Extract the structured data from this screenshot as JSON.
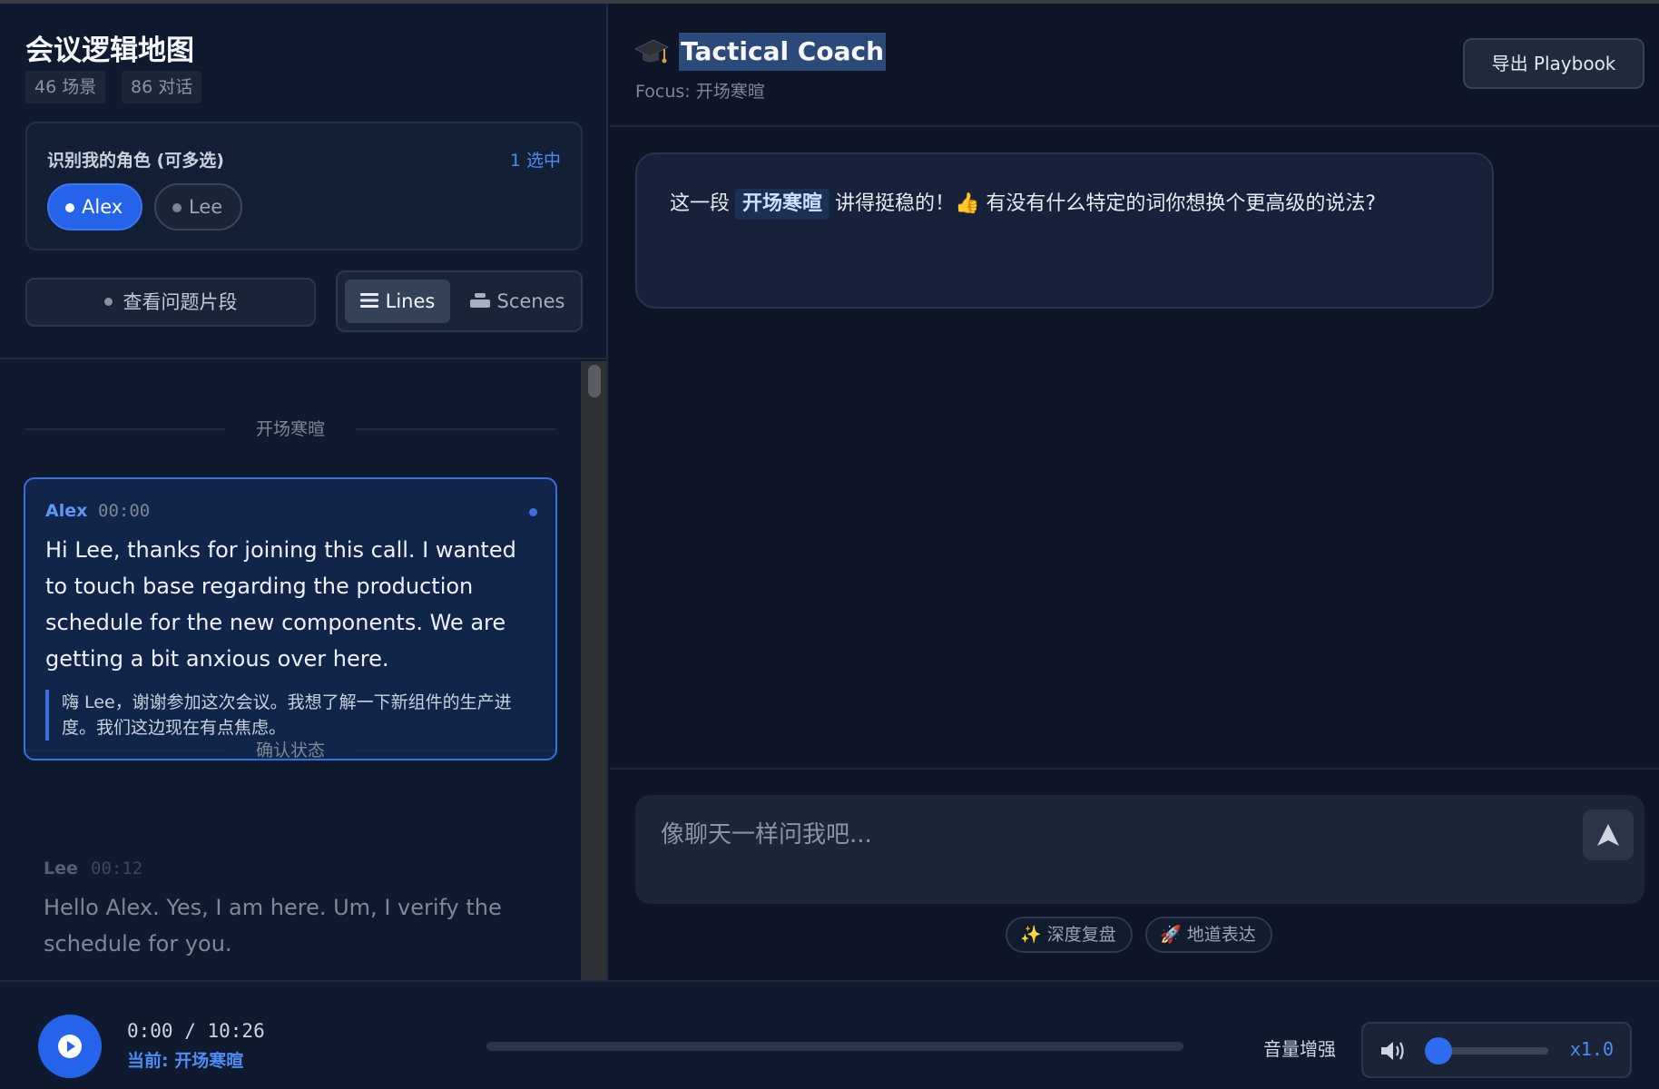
{
  "sidebar": {
    "title": "会议逻辑地图",
    "stats": {
      "scenes": "46 场景",
      "dialogs": "86 对话"
    },
    "roles": {
      "title": "识别我的角色 (可多选)",
      "count": "1 选中",
      "items": [
        {
          "label": "Alex",
          "selected": true
        },
        {
          "label": "Lee",
          "selected": false
        }
      ]
    },
    "issue_button": "查看问题片段",
    "view_toggle": {
      "lines": "Lines",
      "scenes": "Scenes",
      "active": "lines"
    },
    "transcript": [
      {
        "section": "开场寒暄",
        "speaker": "Alex",
        "time": "00:00",
        "text": "Hi Lee, thanks for joining this call. I wanted to touch base regarding the production schedule for the new components. We are getting a bit anxious over here.",
        "translation": "嗨 Lee，谢谢参加这次会议。我想了解一下新组件的生产进度。我们这边现在有点焦虑。"
      },
      {
        "section": "确认状态",
        "speaker": "Lee",
        "time": "00:12",
        "text": "Hello Alex. Yes, I am here. Um, I verify the schedule for you."
      }
    ]
  },
  "coach": {
    "title": "Tactical Coach",
    "focus": "Focus: 开场寒暄",
    "export_button": "导出 Playbook",
    "message": {
      "before": "这一段",
      "highlight": "开场寒暄",
      "after": "讲得挺稳的！👍 有没有什么特定的词你想换个更高级的说法?"
    },
    "input_placeholder": "像聊天一样问我吧...",
    "quick_actions": [
      "✨ 深度复盘",
      "🚀 地道表达"
    ]
  },
  "player": {
    "time": "0:00 / 10:26",
    "current": "当前: 开场寒暄",
    "progress": 0,
    "volume_label": "音量增强",
    "volume_level": 0.1,
    "speed": "x1.0"
  },
  "colors": {
    "accent": "#2563eb",
    "background": "#0d1526",
    "panel": "#0f1a2e"
  },
  "icons": {
    "coach": "graduation-cap-icon",
    "lines": "list-icon",
    "scenes": "stack-icon",
    "send": "send-icon",
    "play": "play-icon",
    "volume": "volume-icon"
  }
}
